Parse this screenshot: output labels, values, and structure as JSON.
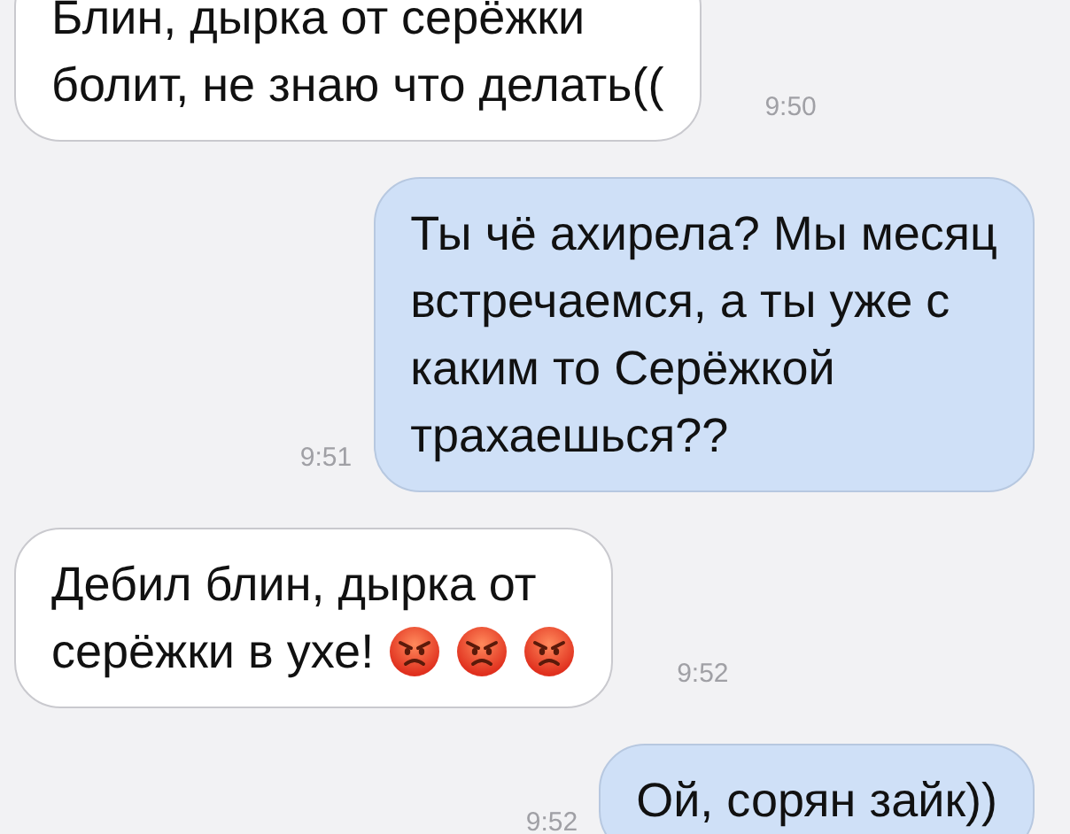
{
  "messages": [
    {
      "kind": "incoming",
      "lines": [
        "Блин, дырка от серёжки",
        "болит, не знаю что делать(("
      ],
      "time": "9:50"
    },
    {
      "kind": "outgoing",
      "lines": [
        "Ты чё ахирела? Мы месяц",
        "встречаемся, а ты уже с",
        "каким то Серёжкой",
        "трахаешься??"
      ],
      "time": "9:51"
    },
    {
      "kind": "incoming",
      "lines": [
        "Дебил блин, дырка от",
        "серёжки в ухе!"
      ],
      "emojis": [
        {
          "kind": "angry"
        },
        {
          "kind": "angry"
        },
        {
          "kind": "angry"
        }
      ],
      "time": "9:52"
    },
    {
      "kind": "outgoing",
      "lines": [
        "Ой, сорян зайк))"
      ],
      "time": "9:52"
    }
  ]
}
